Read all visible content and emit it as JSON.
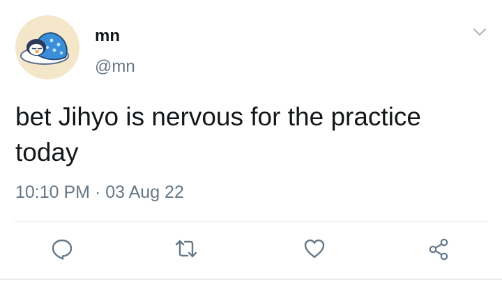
{
  "user": {
    "display_name": "mn",
    "handle": "@mn"
  },
  "tweet": {
    "text": "bet Jihyo is nervous for the practice today",
    "time": "10:10 PM",
    "separator": "·",
    "date": "03 Aug 22"
  },
  "icons": {
    "menu": "chevron-down-icon",
    "reply": "reply-icon",
    "retweet": "retweet-icon",
    "like": "heart-icon",
    "share": "share-icon"
  },
  "colors": {
    "text": "#14171a",
    "secondary": "#657786",
    "divider": "#e1e8ed",
    "avatar_bg": "#f4e6c9"
  }
}
